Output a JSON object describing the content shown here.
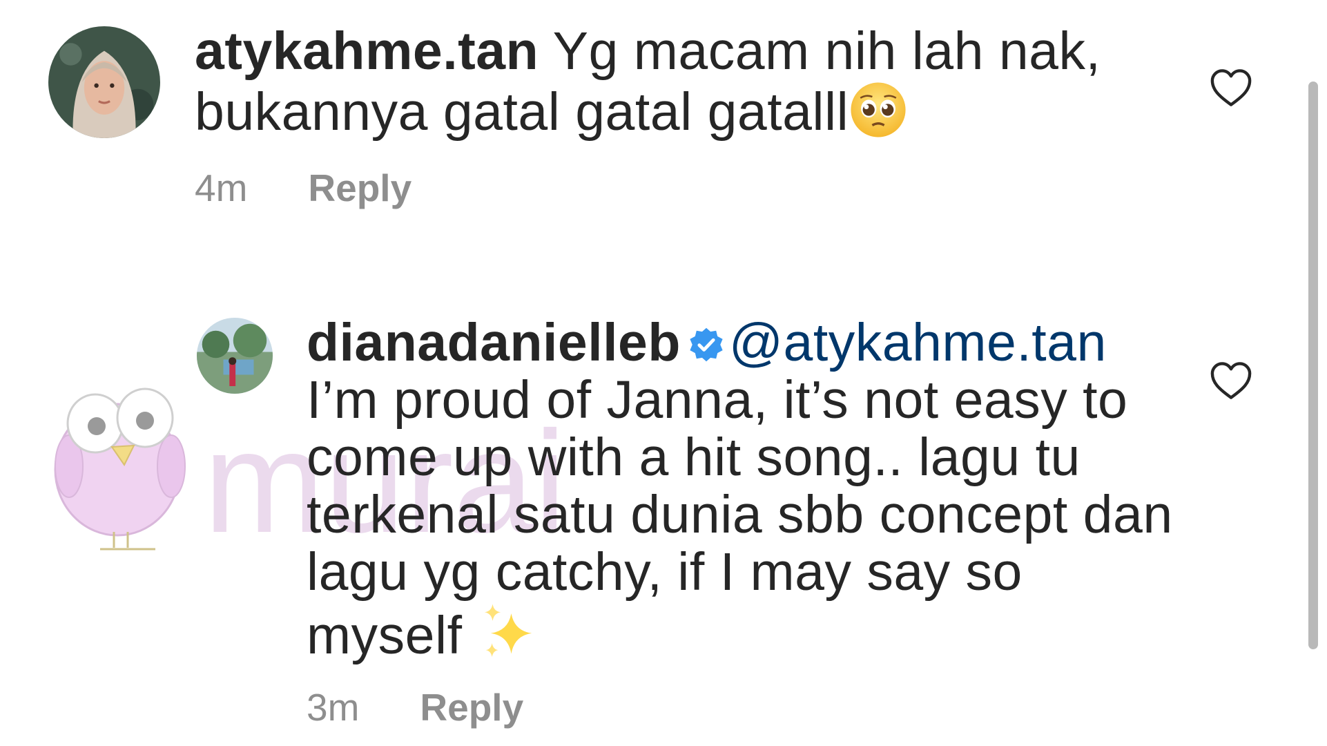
{
  "comments": [
    {
      "username": "atykahme.tan",
      "text": " Yg macam nih lah nak, bukannya gatal gatal gatalll",
      "emoji_icon": "pleading-face-emoji",
      "time": "4m",
      "reply_label": "Reply"
    },
    {
      "username": "dianadanielleb",
      "verified_icon": "verified-badge-icon",
      "mention": "@atykahme.tan",
      "text": "I’m proud of Janna, it’s not easy to come up with a hit song.. lagu tu terkenal satu dunia sbb concept dan lagu yg catchy, if I may say so myself ",
      "emoji_icon": "sparkles-emoji",
      "time": "3m",
      "reply_label": "Reply"
    }
  ],
  "watermark": {
    "text": "murai",
    "mascot_icon": "bird-mascot-icon"
  },
  "colors": {
    "text": "#262626",
    "meta": "#8e8e8e",
    "mention": "#00376b",
    "verified": "#3897f0",
    "watermark": "#e3cbe5"
  }
}
